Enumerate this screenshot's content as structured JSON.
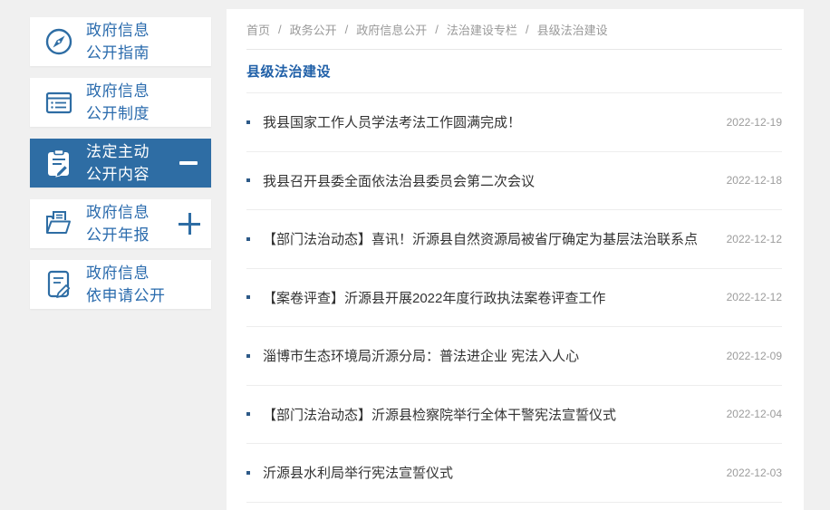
{
  "colors": {
    "accent": "#2e6da4",
    "sidebar_text": "#2a6bad",
    "page_background": "#f0f0f0",
    "title_blue": "#2060a8",
    "muted_gray": "#999999"
  },
  "sidebar": {
    "items": [
      {
        "line1": "政府信息",
        "line2": "公开指南",
        "icon": "compass-icon",
        "active": false
      },
      {
        "line1": "政府信息",
        "line2": "公开制度",
        "icon": "list-doc-icon",
        "active": false
      },
      {
        "line1": "法定主动",
        "line2": "公开内容",
        "icon": "clipboard-pencil-icon",
        "active": true,
        "toggle": "minus"
      },
      {
        "line1": "政府信息",
        "line2": "公开年报",
        "icon": "folder-doc-icon",
        "active": false,
        "toggle": "plus"
      },
      {
        "line1": "政府信息",
        "line2": "依申请公开",
        "icon": "doc-edit-icon",
        "active": false
      }
    ]
  },
  "breadcrumb": {
    "separator": "/",
    "items": [
      "首页",
      "政务公开",
      "政府信息公开",
      "法治建设专栏",
      "县级法治建设"
    ]
  },
  "content": {
    "title": "县级法治建设",
    "articles": [
      {
        "title": "我县国家工作人员学法考法工作圆满完成！",
        "date": "2022-12-19"
      },
      {
        "title": "我县召开县委全面依法治县委员会第二次会议",
        "date": "2022-12-18"
      },
      {
        "title": "【部门法治动态】喜讯！沂源县自然资源局被省厅确定为基层法治联系点",
        "date": "2022-12-12"
      },
      {
        "title": "【案卷评查】沂源县开展2022年度行政执法案卷评查工作",
        "date": "2022-12-12"
      },
      {
        "title": "淄博市生态环境局沂源分局：普法进企业 宪法入人心",
        "date": "2022-12-09"
      },
      {
        "title": "【部门法治动态】沂源县检察院举行全体干警宪法宣誓仪式",
        "date": "2022-12-04"
      },
      {
        "title": "沂源县水利局举行宪法宣誓仪式",
        "date": "2022-12-03"
      }
    ]
  }
}
